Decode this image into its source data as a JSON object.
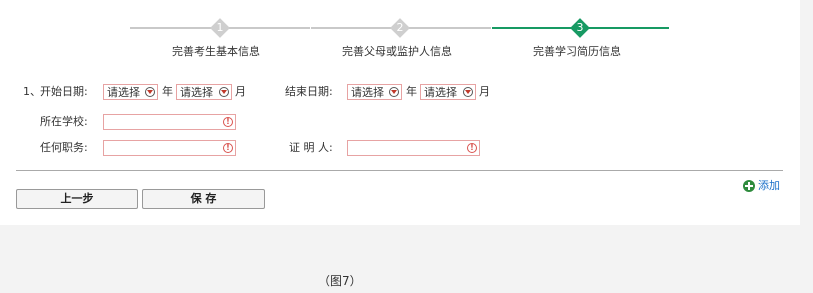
{
  "stepper": {
    "steps": [
      {
        "number": "1",
        "label": "完善考生基本信息",
        "state": "done"
      },
      {
        "number": "2",
        "label": "完善父母或监护人信息",
        "state": "done"
      },
      {
        "number": "3",
        "label": "完善学习简历信息",
        "state": "active"
      }
    ],
    "colors": {
      "active": "#179a63",
      "inactive": "#cfcfcf"
    }
  },
  "form": {
    "row_index": "1、",
    "start_date_label": "开始日期:",
    "end_date_label": "结束日期:",
    "select_placeholder": "请选择",
    "year_unit": "年",
    "month_unit": "月",
    "school_label": "所在学校:",
    "position_label": "任何职务:",
    "witness_label": "证 明 人:",
    "school_value": "",
    "position_value": "",
    "witness_value": ""
  },
  "actions": {
    "prev_label": "上一步",
    "save_label": "保 存",
    "add_label": "添加"
  },
  "caption": "（图7）"
}
